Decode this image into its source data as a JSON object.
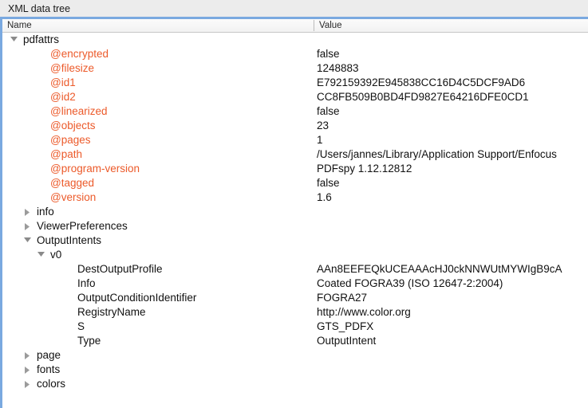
{
  "panel": {
    "title": "XML data tree"
  },
  "columns": {
    "name": "Name",
    "value": "Value"
  },
  "colors": {
    "attribute_text": "#ec5a2a",
    "element_text": "#111111",
    "focus_border": "#7aa9e0",
    "header_bg": "#f2f2f2",
    "window_bg": "#ececec"
  },
  "rows": [
    {
      "name": "pdfattrs",
      "value": "",
      "depth": 0,
      "type": "element",
      "twisty": "expanded"
    },
    {
      "name": "@encrypted",
      "value": "false",
      "depth": 2,
      "type": "attribute",
      "twisty": "none"
    },
    {
      "name": "@filesize",
      "value": "1248883",
      "depth": 2,
      "type": "attribute",
      "twisty": "none"
    },
    {
      "name": "@id1",
      "value": "E792159392E945838CC16D4C5DCF9AD6",
      "depth": 2,
      "type": "attribute",
      "twisty": "none"
    },
    {
      "name": "@id2",
      "value": "CC8FB509B0BD4FD9827E64216DFE0CD1",
      "depth": 2,
      "type": "attribute",
      "twisty": "none"
    },
    {
      "name": "@linearized",
      "value": "false",
      "depth": 2,
      "type": "attribute",
      "twisty": "none"
    },
    {
      "name": "@objects",
      "value": "23",
      "depth": 2,
      "type": "attribute",
      "twisty": "none"
    },
    {
      "name": "@pages",
      "value": "1",
      "depth": 2,
      "type": "attribute",
      "twisty": "none"
    },
    {
      "name": "@path",
      "value": "/Users/jannes/Library/Application Support/Enfocus",
      "depth": 2,
      "type": "attribute",
      "twisty": "none"
    },
    {
      "name": "@program-version",
      "value": "PDFspy 1.12.12812",
      "depth": 2,
      "type": "attribute",
      "twisty": "none"
    },
    {
      "name": "@tagged",
      "value": "false",
      "depth": 2,
      "type": "attribute",
      "twisty": "none"
    },
    {
      "name": "@version",
      "value": "1.6",
      "depth": 2,
      "type": "attribute",
      "twisty": "none"
    },
    {
      "name": "info",
      "value": "",
      "depth": 1,
      "type": "element",
      "twisty": "collapsed"
    },
    {
      "name": "ViewerPreferences",
      "value": "",
      "depth": 1,
      "type": "element",
      "twisty": "collapsed"
    },
    {
      "name": "OutputIntents",
      "value": "",
      "depth": 1,
      "type": "element",
      "twisty": "expanded"
    },
    {
      "name": "v0",
      "value": "",
      "depth": 2,
      "type": "element",
      "twisty": "expanded"
    },
    {
      "name": "DestOutputProfile",
      "value": "AAn8EEFEQkUCEAAAcHJ0ckNNWUtMYWIgB9cA",
      "depth": 4,
      "type": "element",
      "twisty": "none"
    },
    {
      "name": "Info",
      "value": "Coated FOGRA39 (ISO 12647-2:2004)",
      "depth": 4,
      "type": "element",
      "twisty": "none"
    },
    {
      "name": "OutputConditionIdentifier",
      "value": "FOGRA27",
      "depth": 4,
      "type": "element",
      "twisty": "none"
    },
    {
      "name": "RegistryName",
      "value": "http://www.color.org",
      "depth": 4,
      "type": "element",
      "twisty": "none"
    },
    {
      "name": "S",
      "value": "GTS_PDFX",
      "depth": 4,
      "type": "element",
      "twisty": "none"
    },
    {
      "name": "Type",
      "value": "OutputIntent",
      "depth": 4,
      "type": "element",
      "twisty": "none"
    },
    {
      "name": "page",
      "value": "",
      "depth": 1,
      "type": "element",
      "twisty": "collapsed"
    },
    {
      "name": "fonts",
      "value": "",
      "depth": 1,
      "type": "element",
      "twisty": "collapsed"
    },
    {
      "name": "colors",
      "value": "",
      "depth": 1,
      "type": "element",
      "twisty": "collapsed"
    }
  ]
}
